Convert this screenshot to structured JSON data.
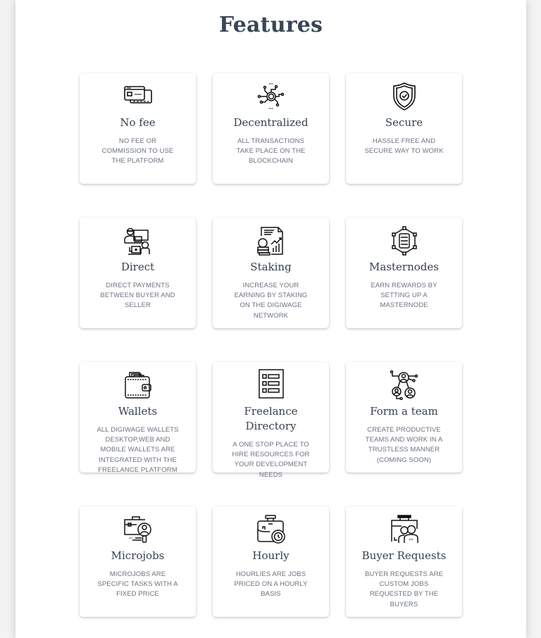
{
  "section_title": "Features",
  "features": [
    {
      "icon": "credit-cards-icon",
      "title": "No fee",
      "description": "NO FEE OR COMMISSION TO USE THE PLATFORM"
    },
    {
      "icon": "circuit-chip-icon",
      "title": "Decentralized",
      "description": "ALL TRANSACTIONS TAKE PLACE ON THE BLOCKCHAIN"
    },
    {
      "icon": "shield-check-icon",
      "title": "Secure",
      "description": "HASSLE FREE AND SECURE WAY TO WORK"
    },
    {
      "icon": "buyer-seller-laptops-icon",
      "title": "Direct",
      "description": "DIRECT PAYMENTS BETWEEN BUYER AND SELLER"
    },
    {
      "icon": "coins-chart-report-icon",
      "title": "Staking",
      "description": "INCREASE YOUR EARNING BY STAKING ON THE DIGIWAGE NETWORK"
    },
    {
      "icon": "server-network-icon",
      "title": "Masternodes",
      "description": "EARN REWARDS BY SETTING UP A MASTERNODE"
    },
    {
      "icon": "wallet-icon",
      "title": "Wallets",
      "description": "ALL DIGIWAGE WALLETS DESKTOP,WEB AND MOBILE WALLETS ARE INTEGRATED WITH THE FREELANCE PLATFORM"
    },
    {
      "icon": "directory-list-icon",
      "title": "Freelance Directory",
      "description": "A ONE STOP PLACE TO HIRE RESOURCES FOR YOUR DEVELOPMENT NEEDS"
    },
    {
      "icon": "team-network-icon",
      "title": "Form a team",
      "description": "CREATE PRODUCTIVE TEAMS AND WORK IN A TRUSTLESS MANNER (COMING SOON)"
    },
    {
      "icon": "briefcase-search-user-icon",
      "title": "Microjobs",
      "description": "MICROJOBS ARE SPECIFIC TASKS WITH A FIXED PRICE"
    },
    {
      "icon": "briefcase-clock-icon",
      "title": "Hourly",
      "description": "HOURLIES ARE JOBS PRICED ON A HOURLY BASIS"
    },
    {
      "icon": "briefcase-users-icon",
      "title": "Buyer Requests",
      "description": "BUYER REQUESTS ARE CUSTOM JOBS REQUESTED BY THE BUYERS"
    }
  ],
  "colors": {
    "title": "#3a4556",
    "card_title": "#36404f",
    "card_text": "#6b7280",
    "page_bg": "#ffffff",
    "outer_bg": "#f3f3f3"
  }
}
